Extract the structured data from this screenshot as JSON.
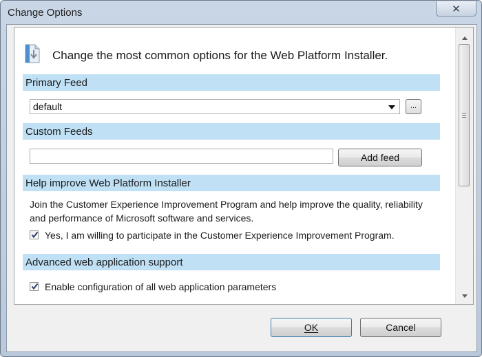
{
  "window": {
    "title": "Change Options",
    "close_glyph": "✕"
  },
  "header": {
    "icon": "installer-icon",
    "text": "Change the most common options for the Web Platform Installer."
  },
  "sections": {
    "primary_feed": {
      "title": "Primary Feed",
      "selected": "default",
      "browse_label": "..."
    },
    "custom_feeds": {
      "title": "Custom Feeds",
      "input_value": "",
      "add_label": "Add feed"
    },
    "help_improve": {
      "title": "Help improve Web Platform Installer",
      "description": "Join the Customer Experience Improvement Program and help improve the quality, reliability and performance of Microsoft software and services.",
      "checkbox_label": "Yes, I am willing to participate in the Customer Experience Improvement Program.",
      "checked": true
    },
    "advanced": {
      "title": "Advanced web application support",
      "checkbox_label": "Enable configuration of all web application parameters",
      "checked": true
    }
  },
  "footer": {
    "ok_label": "OK",
    "cancel_label": "Cancel"
  }
}
